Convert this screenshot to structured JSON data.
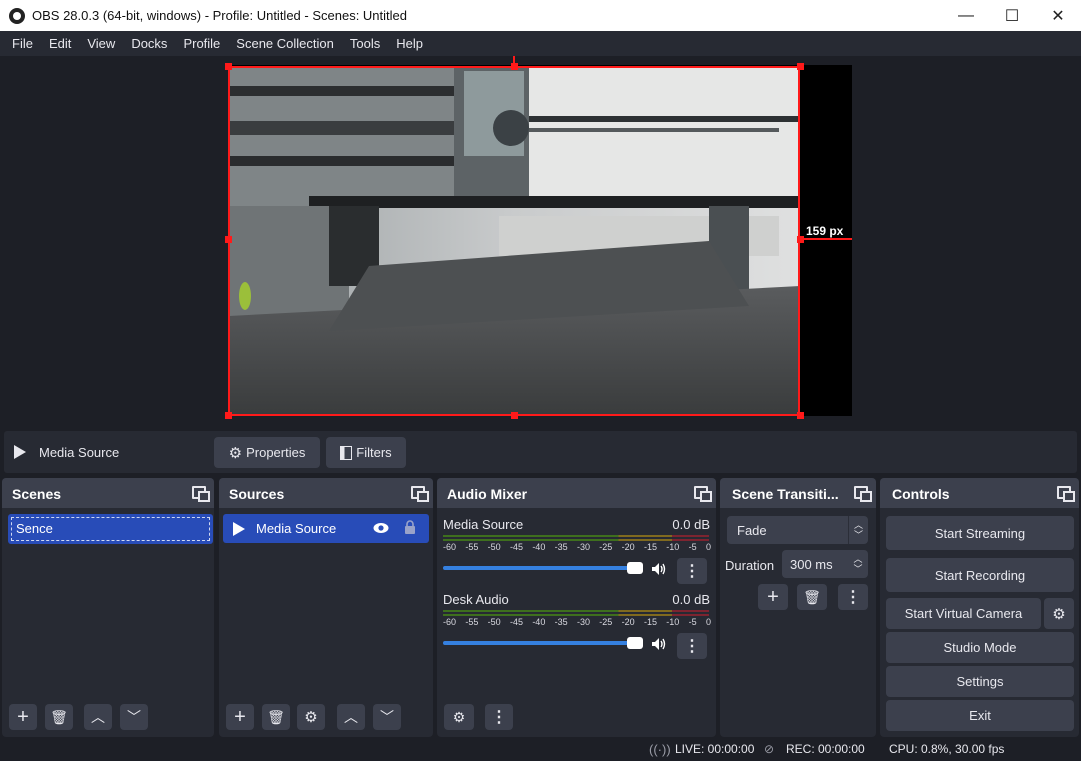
{
  "window": {
    "title": "OBS 28.0.3 (64-bit, windows) - Profile: Untitled - Scenes: Untitled",
    "min": "—",
    "max": "☐",
    "close": "✕"
  },
  "menu": [
    "File",
    "Edit",
    "View",
    "Docks",
    "Profile",
    "Scene Collection",
    "Tools",
    "Help"
  ],
  "preview": {
    "measure_label": "159 px"
  },
  "source_toolbar": {
    "source_name": "Media Source",
    "properties": "Properties",
    "filters": "Filters"
  },
  "scenes": {
    "title": "Scenes",
    "items": [
      "Sence"
    ]
  },
  "sources": {
    "title": "Sources",
    "items": [
      "Media Source"
    ]
  },
  "mixer": {
    "title": "Audio Mixer",
    "ticks": [
      "-60",
      "-55",
      "-50",
      "-45",
      "-40",
      "-35",
      "-30",
      "-25",
      "-20",
      "-15",
      "-10",
      "-5",
      "0"
    ],
    "channels": [
      {
        "name": "Media Source",
        "db": "0.0 dB",
        "volume": 1.0
      },
      {
        "name": "Desk Audio",
        "db": "0.0 dB",
        "volume": 1.0
      }
    ]
  },
  "transitions": {
    "title": "Scene Transiti...",
    "selected": "Fade",
    "duration_label": "Duration",
    "duration_value": "300 ms"
  },
  "controls": {
    "title": "Controls",
    "start_streaming": "Start Streaming",
    "start_recording": "Start Recording",
    "start_virtual_camera": "Start Virtual Camera",
    "studio_mode": "Studio Mode",
    "settings": "Settings",
    "exit": "Exit"
  },
  "status": {
    "live": "LIVE: 00:00:00",
    "rec": "REC: 00:00:00",
    "cpu": "CPU: 0.8%, 30.00 fps"
  },
  "colors": {
    "accent": "#284cb8",
    "selection": "#ff1a1a",
    "slider": "#3580e0"
  }
}
